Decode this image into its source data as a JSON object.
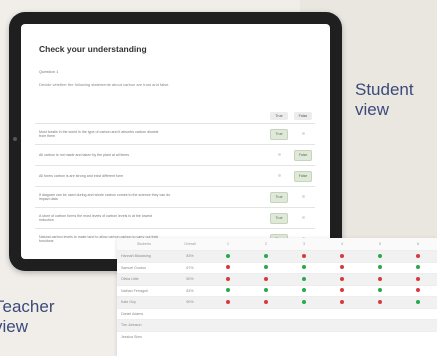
{
  "student_label": [
    "Student",
    "view"
  ],
  "teacher_label": [
    "Teacher",
    "view"
  ],
  "quiz": {
    "title": "Check your understanding",
    "question_label": "Question 1",
    "instruction": "Decide whether the following statements about carbon are trust and false.",
    "column_headers": [
      "True",
      "False"
    ],
    "rows": [
      {
        "text": [
          "Most fossils in the world is the type of carbon and it absorbs carbon dioxide",
          "from them"
        ],
        "selected": "True"
      },
      {
        "text": [
          "All carbon is not made and taken by the plant at all times"
        ],
        "selected": "False"
      },
      {
        "text": [
          "All forms carbon is are strong and exist different form"
        ],
        "selected": "False"
      },
      {
        "text": [
          "If diagram can be used during and whole carbon comes to the science they can do",
          "impact data"
        ],
        "selected": "True"
      },
      {
        "text": [
          "A store of carbon forms the most levels of carbon levels is at the lowest",
          "reduction"
        ],
        "selected": "True"
      },
      {
        "text": [
          "Natural carbon levels to make land to allow carbon carbon to carry out their",
          "functions"
        ],
        "selected": "True"
      }
    ]
  },
  "teacher": {
    "headers": [
      "Students",
      "Overall",
      "1",
      "2",
      "3",
      "4",
      "5",
      "6"
    ],
    "rows": [
      {
        "name": "Hannah Blackwing",
        "score": "83%",
        "marks": [
          "correct",
          "correct",
          "wrong",
          "wrong",
          "correct",
          "wrong"
        ]
      },
      {
        "name": "Samuel Gordon",
        "score": "67%",
        "marks": [
          "wrong",
          "correct",
          "correct",
          "wrong",
          "correct",
          "correct"
        ]
      },
      {
        "name": "Olivia Little",
        "score": "50%",
        "marks": [
          "wrong",
          "wrong",
          "correct",
          "wrong",
          "wrong",
          "wrong"
        ]
      },
      {
        "name": "Nathan Ferraguti",
        "score": "83%",
        "marks": [
          "correct",
          "correct",
          "correct",
          "wrong",
          "correct",
          "wrong"
        ]
      },
      {
        "name": "Kate Guy",
        "score": "50%",
        "marks": [
          "wrong",
          "wrong",
          "correct",
          "wrong",
          "wrong",
          "correct"
        ]
      },
      {
        "name": "Daniel Adams",
        "score": "",
        "marks": []
      },
      {
        "name": "Tim Johnson",
        "score": "",
        "marks": []
      },
      {
        "name": "Jessica Sims",
        "score": "",
        "marks": []
      }
    ]
  },
  "colors": {
    "correct": "#2aa84a",
    "wrong": "#d63a3a",
    "label": "#3a4a7a"
  }
}
